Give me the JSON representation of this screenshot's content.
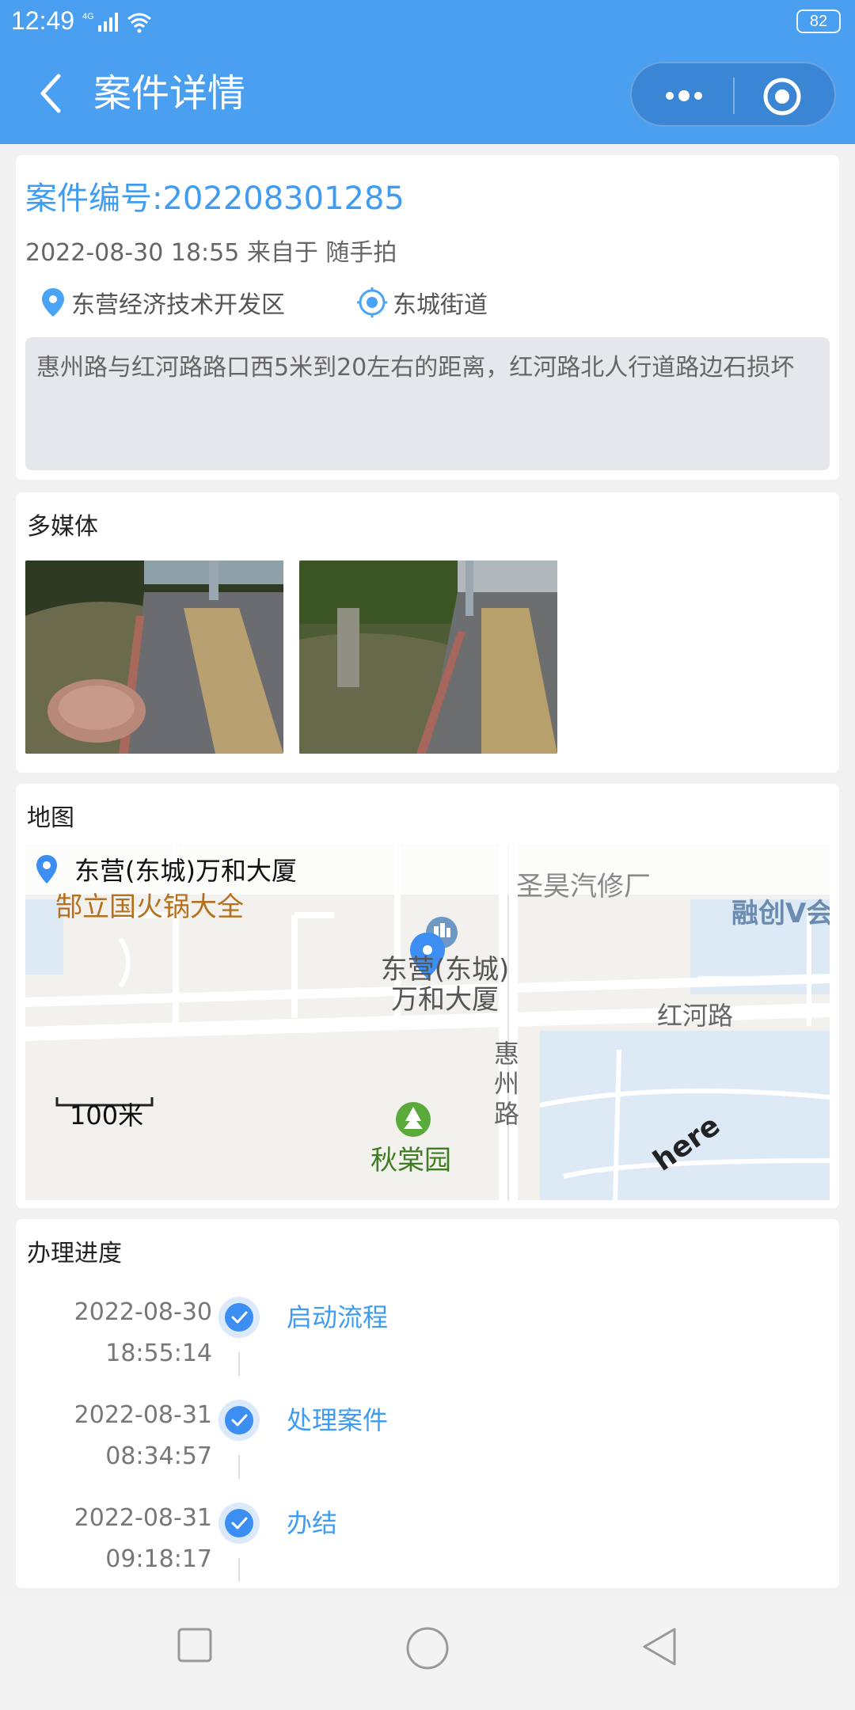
{
  "status_bar": {
    "time": "12:49",
    "network": "4G",
    "battery": "82"
  },
  "header": {
    "title": "案件详情"
  },
  "case": {
    "number": "案件编号:202208301285",
    "meta": "2022-08-30 18:55 来自于 随手拍",
    "district": "东营经济技术开发区",
    "street": "东城街道",
    "description": "惠州路与红河路路口西5米到20左右的距离，红河路北人行道路边石损坏"
  },
  "media": {
    "title": "多媒体",
    "photo_count": 2
  },
  "map": {
    "title": "地图",
    "location": "东营(东城)万和大厦",
    "labels": {
      "repair_shop": "圣昊汽修厂",
      "hotpot": "郜立国火锅大全",
      "rongchuang": "融创V会",
      "building": "东营(东城)万和大厦",
      "hongheroad": "红河路",
      "huizhouroad": "惠州路",
      "garden": "秋棠园",
      "scale": "100米",
      "brand": "here"
    }
  },
  "progress": {
    "title": "办理进度",
    "items": [
      {
        "date": "2022-08-30",
        "time": "18:55:14",
        "step": "启动流程"
      },
      {
        "date": "2022-08-31",
        "time": "08:34:57",
        "step": "处理案件"
      },
      {
        "date": "2022-08-31",
        "time": "09:18:17",
        "step": "办结"
      }
    ]
  },
  "colors": {
    "primary": "#4a9ff0",
    "link": "#3f9cf1",
    "accent": "#3c8ef3"
  }
}
